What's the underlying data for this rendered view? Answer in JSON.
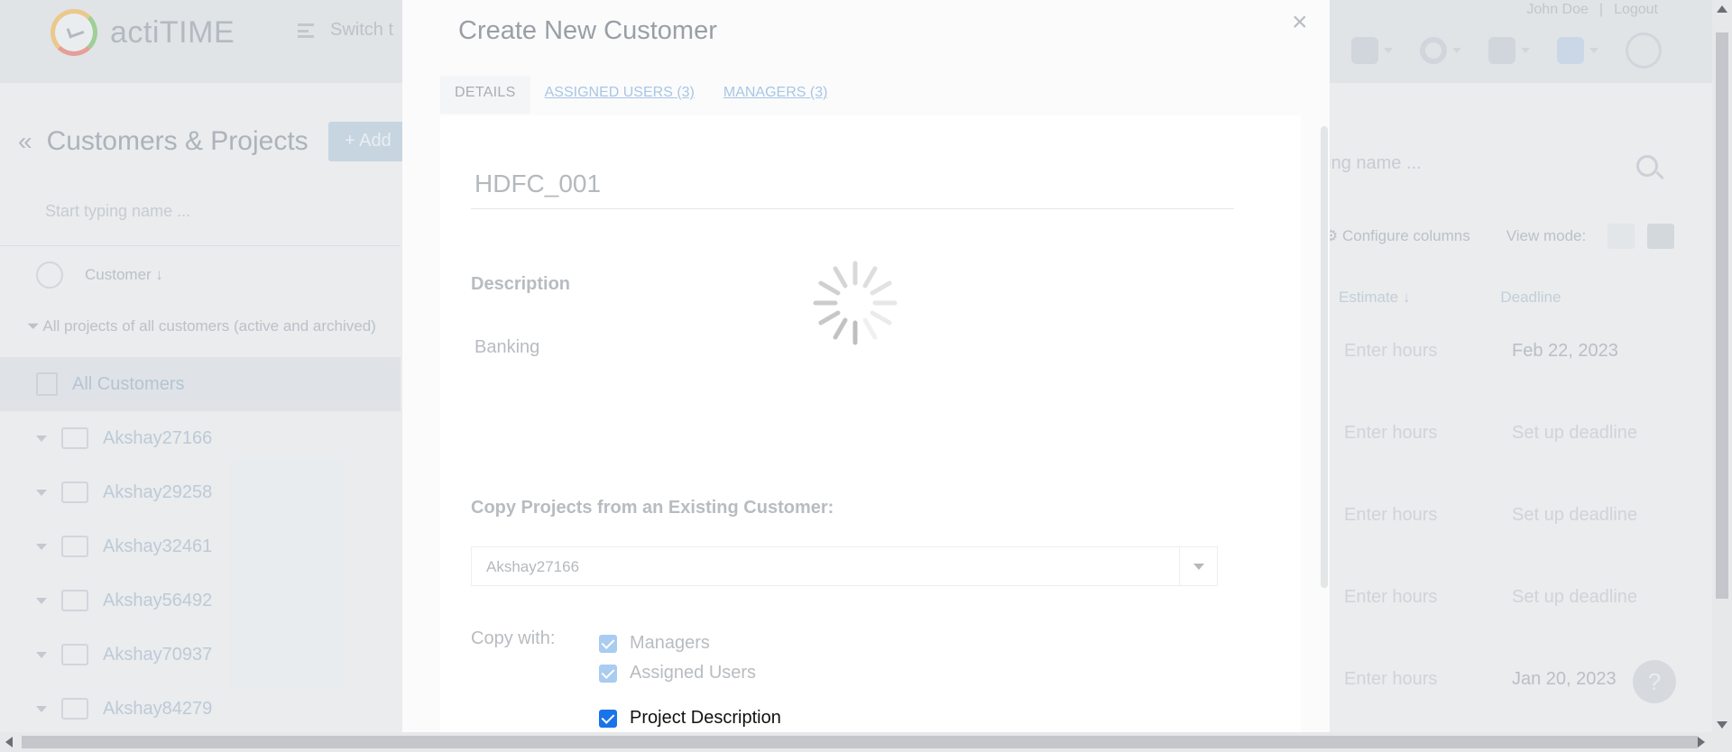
{
  "app": {
    "logo_text": "actiTIME",
    "switch_text": "Switch t",
    "user_name": "John Doe",
    "logout_label": "Logout",
    "icons": [
      "calendar-icon",
      "gear-icon",
      "puzzle-icon",
      "help-icon",
      "lightbulb-icon"
    ]
  },
  "page": {
    "title": "Customers & Projects",
    "add_label": "+ Add"
  },
  "left_panel": {
    "search_placeholder": "Start typing name ...",
    "sort_label": "Customer ↓",
    "filter_text": "All projects of all customers (active and archived)",
    "all_customers": "All Customers",
    "customers": [
      "Akshay27166",
      "Akshay29258",
      "Akshay32461",
      "Akshay56492",
      "Akshay70937",
      "Akshay84279"
    ]
  },
  "right_panel": {
    "search_placeholder": "ping name ...",
    "configure_columns": "Configure columns",
    "view_mode_label": "View mode:",
    "col_estimate": "Estimate ↓",
    "col_deadline": "Deadline",
    "rows": [
      {
        "hours": "Enter hours",
        "deadline": "Feb 22, 2023",
        "empty": false
      },
      {
        "hours": "Enter hours",
        "deadline": "Set up deadline",
        "empty": true
      },
      {
        "hours": "Enter hours",
        "deadline": "Set up deadline",
        "empty": true
      },
      {
        "hours": "Enter hours",
        "deadline": "Set up deadline",
        "empty": true
      },
      {
        "hours": "Enter hours",
        "deadline": "Jan 20, 2023",
        "empty": false
      }
    ],
    "help_label": "?"
  },
  "modal": {
    "title": "Create New Customer",
    "close_glyph": "×",
    "tabs": [
      {
        "label": "DETAILS",
        "active": true
      },
      {
        "label": "ASSIGNED USERS (3)",
        "active": false
      },
      {
        "label": "MANAGERS (3)",
        "active": false
      }
    ],
    "name_value": "HDFC_001",
    "description_label": "Description",
    "description_value": "Banking",
    "copy_projects_label": "Copy Projects from an Existing Customer:",
    "copy_from_value": "Akshay27166",
    "copy_with_label": "Copy with:",
    "copy_options": [
      "Managers",
      "Assigned Users",
      "Project Description"
    ]
  },
  "colors": {
    "accent": "#1a73e8",
    "link": "#a8c6e3"
  }
}
